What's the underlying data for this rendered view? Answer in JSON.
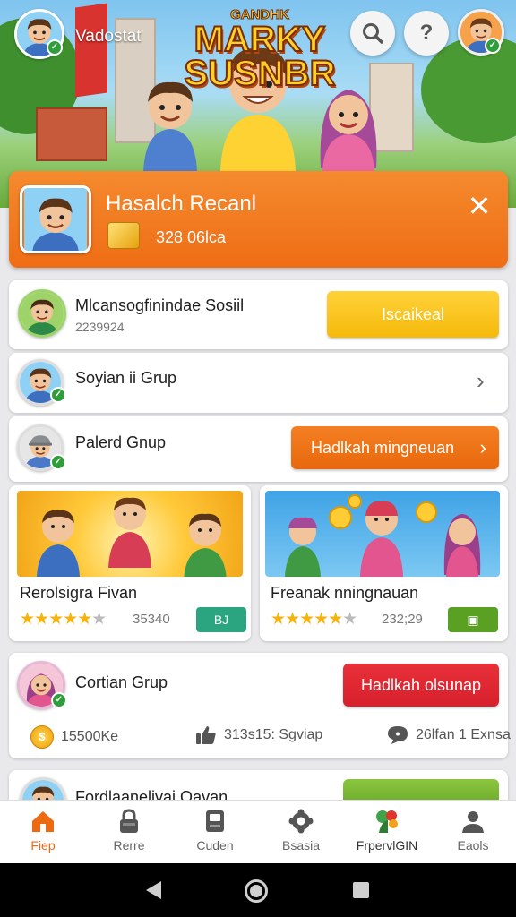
{
  "header": {
    "user_name": "Vadostat",
    "logo_line1": "GANDHK",
    "logo_line2": "MARKY",
    "logo_line3": "SUSNBR",
    "search_icon": "search-icon",
    "help_label": "?"
  },
  "banner": {
    "title": "Hasalch Recanl",
    "coins": "328 06lca",
    "close_label": "✕"
  },
  "cards": [
    {
      "title": "Mlcansogfinindae Sosiil",
      "subtitle": "2239924",
      "button": "Iscaikeal"
    },
    {
      "title": "Soyian ii Grup"
    },
    {
      "title": "Palerd Gnup",
      "button": "Hadlkah mingneuan"
    }
  ],
  "games": [
    {
      "title": "Rerolsigra Fivan",
      "count": "35340",
      "tag": "BJ",
      "rating": 4.5,
      "tag_color": "#2aa580"
    },
    {
      "title": "Freanak nningnauan",
      "count": "232;29",
      "tag": "▣",
      "rating": 4.5,
      "tag_color": "#5aa023"
    }
  ],
  "group_card": {
    "title": "Cortian Grup",
    "button": "Hadlkah olsunap",
    "stat1": "15500Ke",
    "stat2": "313s15: Sgviap",
    "stat3": "26lfan 1 Exnsa"
  },
  "partial_card": {
    "title": "Fordlaanelivai Oavan"
  },
  "nav": [
    {
      "label": "Fiep",
      "icon": "home-icon"
    },
    {
      "label": "Rerre",
      "icon": "lock-icon"
    },
    {
      "label": "Cuden",
      "icon": "book-icon"
    },
    {
      "label": "Bsasia",
      "icon": "gear-icon"
    },
    {
      "label": "FrpervlGIN",
      "icon": "flower-icon"
    },
    {
      "label": "Eaols",
      "icon": "person-icon"
    }
  ],
  "colors": {
    "accent": "#ef6d15",
    "yellow": "#f5b90a",
    "red": "#d6202b",
    "green": "#6aa92a"
  }
}
